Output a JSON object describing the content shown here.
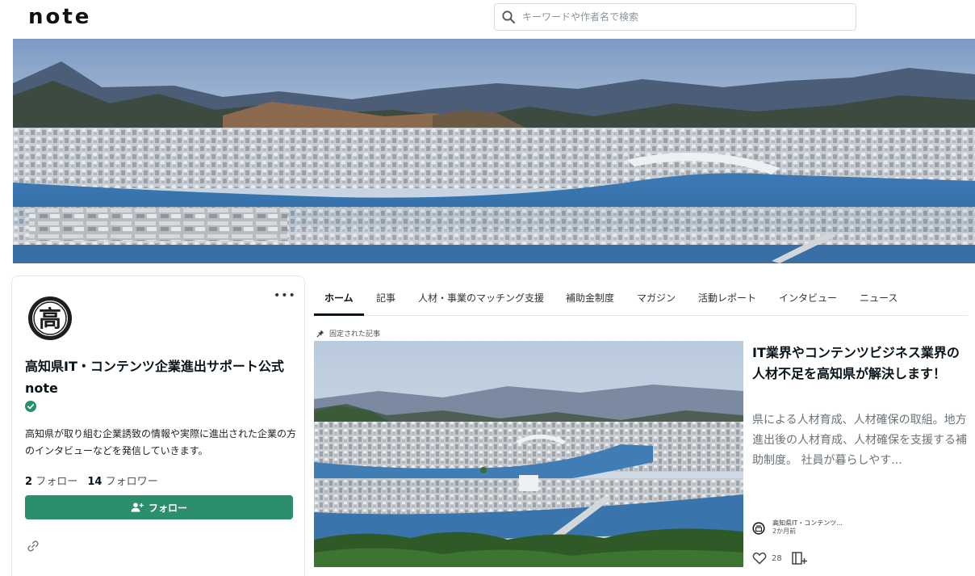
{
  "header": {
    "logo": "note",
    "search": {
      "placeholder": "キーワードや作者名で検索"
    }
  },
  "creator": {
    "name": "高知県IT・コンテンツ企業進出サポート公式note",
    "bio": "高知県が取り組む企業誘致の情報や実際に進出された企業の方のインタビューなどを発信していきます。",
    "following_count": "2",
    "following_label": "フォロー",
    "followers_count": "14",
    "followers_label": "フォロワー",
    "follow_button_label": "フォロー",
    "avatar_char": "高",
    "more_label": "•••"
  },
  "tabs": [
    {
      "label": "ホーム"
    },
    {
      "label": "記事"
    },
    {
      "label": "人材・事業のマッチング支援"
    },
    {
      "label": "補助金制度"
    },
    {
      "label": "マガジン"
    },
    {
      "label": "活動レポート"
    },
    {
      "label": "インタビュー"
    },
    {
      "label": "ニュース"
    }
  ],
  "pinned_label": "固定された記事",
  "article": {
    "title": "IT業界やコンテンツビジネス業界の人材不足を高知県が解決します！",
    "excerpt": "県による人材育成、人材確保の取組。地方進出後の人材育成、人材確保を支援する補助制度。 社員が暮らしやす...",
    "author": "高知県IT・コンテンツ...",
    "date": "2か月前",
    "likes": "28"
  },
  "colors": {
    "accent_green": "#2c8e6f",
    "text_primary": "#08131a",
    "text_muted": "#6b7378",
    "border": "#e2e6e8"
  }
}
